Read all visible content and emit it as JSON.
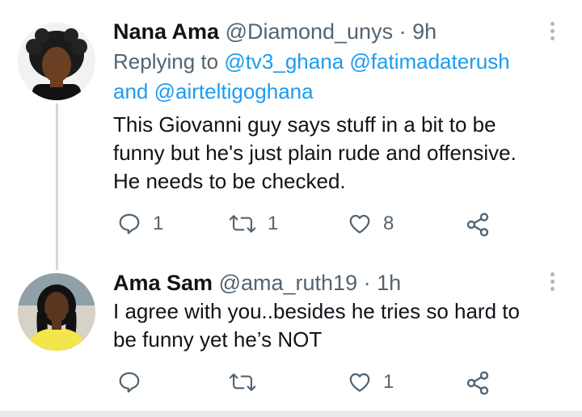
{
  "tweets": [
    {
      "name": "Nana Ama",
      "handle": "@Diamond_unys",
      "dot": "·",
      "time": "9h",
      "replying_prefix": "Replying to",
      "mentions": [
        "@tv3_ghana",
        "@fatimadaterush"
      ],
      "and_text": "and",
      "mention_last": "@airteltigoghana",
      "text_lines": [
        "This Giovanni guy says stuff in a bit to be",
        "funny but he's just plain rude and offensive.",
        "He needs to be checked."
      ],
      "reply_count": "1",
      "retweet_count": "1",
      "like_count": "8"
    },
    {
      "name": "Ama Sam",
      "handle": "@ama_ruth19",
      "dot": "·",
      "time": "1h",
      "text_lines": [
        "I agree with you..besides he tries so hard to",
        "be funny yet he’s NOT"
      ],
      "like_count": "1"
    }
  ],
  "icons": {
    "reply": "reply-icon",
    "retweet": "retweet-icon",
    "like": "heart-icon",
    "share": "share-icon",
    "more": "more-icon"
  },
  "colors": {
    "link": "#1d9bf0",
    "muted": "#536471",
    "text": "#0f1419",
    "thread_line": "#cfd9de"
  }
}
